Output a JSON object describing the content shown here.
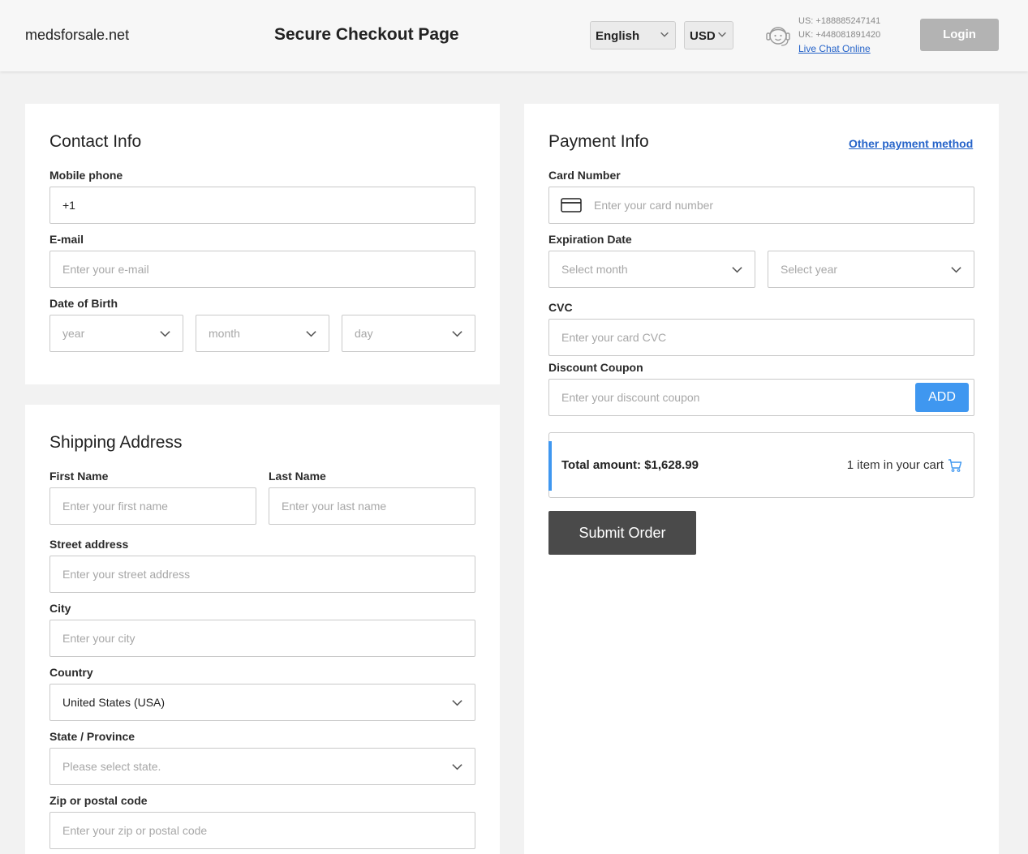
{
  "header": {
    "brand": "medsforsale.net",
    "title": "Secure Checkout Page",
    "language": "English",
    "currency": "USD",
    "phone_us": "US: +188885247141",
    "phone_uk": "UK: +448081891420",
    "live_chat": "Live Chat Online",
    "login": "Login"
  },
  "contact": {
    "heading": "Contact Info",
    "phone_label": "Mobile phone",
    "phone_value": "+1",
    "email_label": "E-mail",
    "email_placeholder": "Enter your e-mail",
    "dob_label": "Date of Birth",
    "dob_year": "year",
    "dob_month": "month",
    "dob_day": "day"
  },
  "shipping": {
    "heading": "Shipping Address",
    "first_name_label": "First Name",
    "first_name_placeholder": "Enter your first name",
    "last_name_label": "Last Name",
    "last_name_placeholder": "Enter your last name",
    "street_label": "Street address",
    "street_placeholder": "Enter your street address",
    "city_label": "City",
    "city_placeholder": "Enter your city",
    "country_label": "Country",
    "country_value": "United States (USA)",
    "state_label": "State / Province",
    "state_placeholder": "Please select state.",
    "zip_label": "Zip or postal code",
    "zip_placeholder": "Enter your zip or postal code"
  },
  "payment": {
    "heading": "Payment Info",
    "other_method": "Other payment method",
    "card_label": "Card Number",
    "card_placeholder": "Enter your card number",
    "exp_label": "Expiration Date",
    "exp_month": "Select month",
    "exp_year": "Select year",
    "cvc_label": "CVC",
    "cvc_placeholder": "Enter your card CVC",
    "coupon_label": "Discount Coupon",
    "coupon_placeholder": "Enter your discount coupon",
    "add_button": "ADD",
    "total": "Total amount: $1,628.99",
    "cart_count": "1 item in your cart",
    "submit": "Submit Order"
  },
  "colors": {
    "accent": "#3f97f0",
    "link": "#2563c9",
    "submit": "#4a4a4a",
    "login": "#b3b3b3"
  },
  "icons": [
    "chevron-down-icon",
    "support-agent-icon",
    "credit-card-icon",
    "shopping-cart-icon"
  ]
}
